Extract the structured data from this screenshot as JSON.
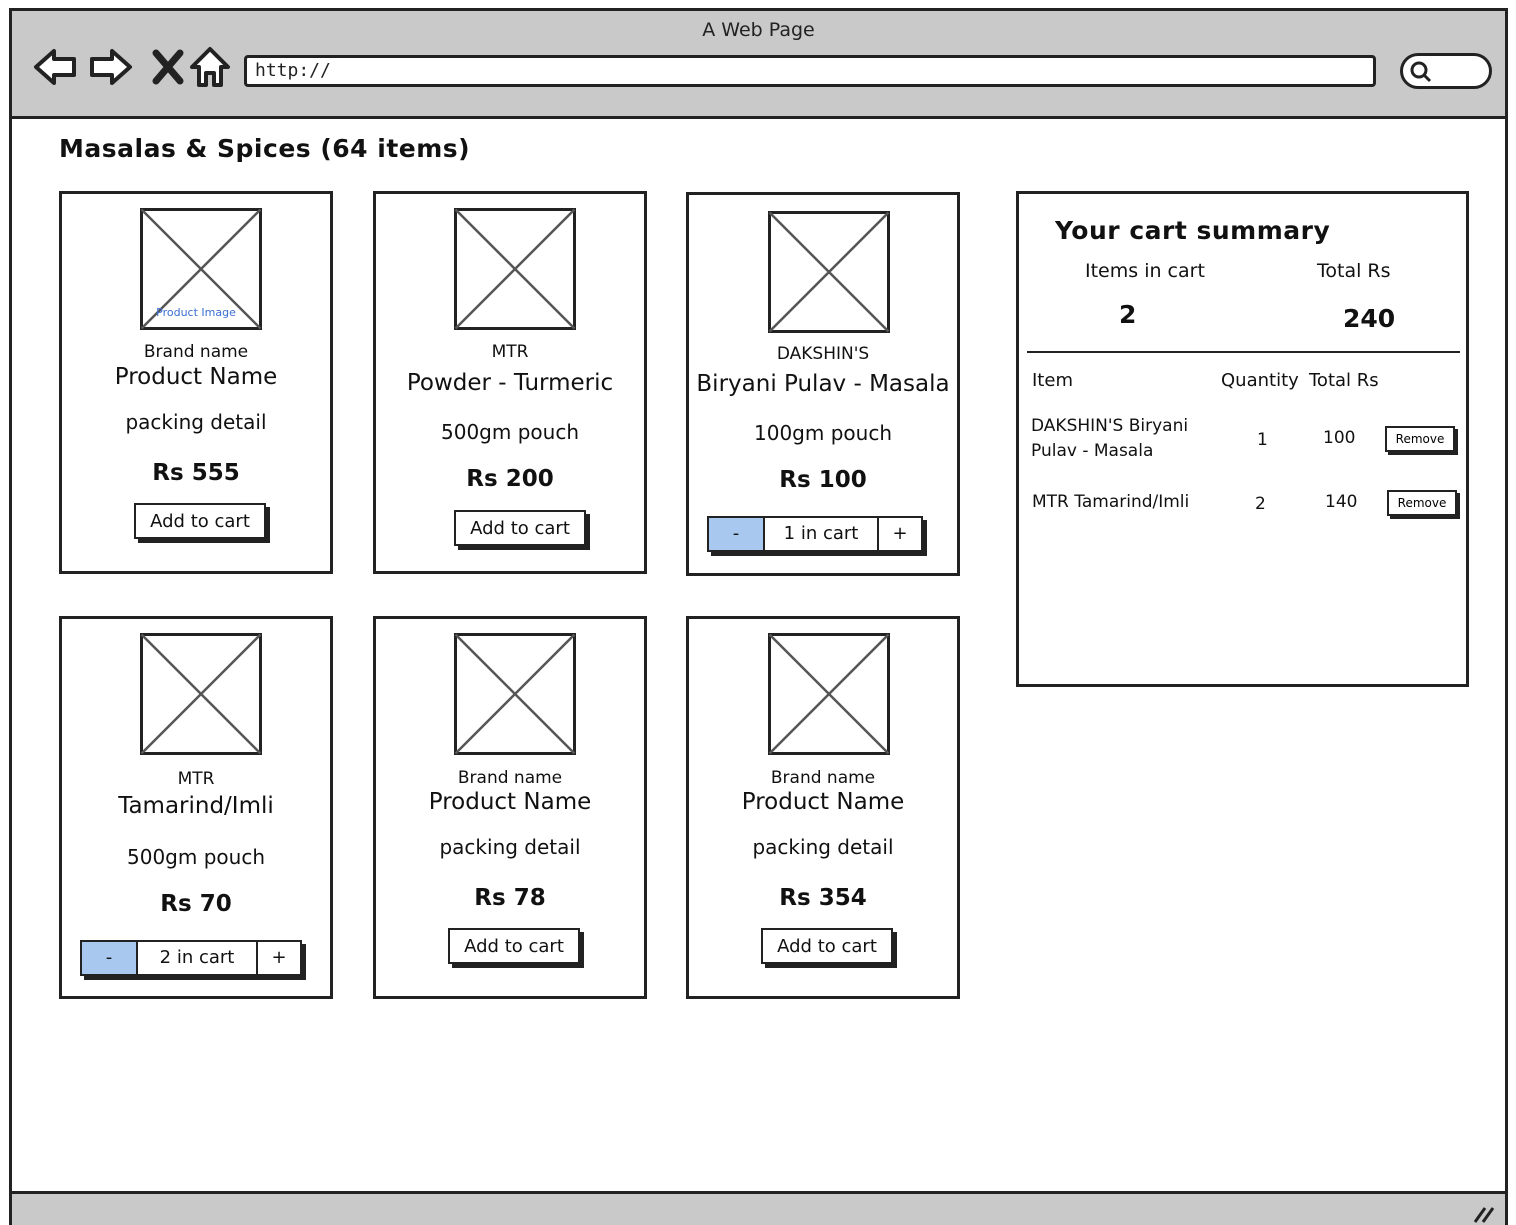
{
  "browser": {
    "window_title": "A Web Page",
    "url": "http://"
  },
  "page": {
    "heading": "Masalas & Spices (64 items)"
  },
  "products": [
    {
      "brand": "Brand name",
      "name": "Product Name",
      "packing": "packing detail",
      "price": "Rs 555",
      "image_caption": "Product Image",
      "action": "add",
      "button_label": "Add to cart"
    },
    {
      "brand": "MTR",
      "name": "Powder - Turmeric",
      "packing": "500gm pouch",
      "price": "Rs 200",
      "action": "add",
      "button_label": "Add to cart"
    },
    {
      "brand": "DAKSHIN'S",
      "name": "Biryani Pulav - Masala",
      "packing": "100gm pouch",
      "price": "Rs 100",
      "action": "stepper",
      "minus_label": "-",
      "count_label": "1 in cart",
      "plus_label": "+"
    },
    {
      "brand": "MTR",
      "name": "Tamarind/Imli",
      "packing": "500gm pouch",
      "price": "Rs 70",
      "action": "stepper",
      "minus_label": "-",
      "count_label": "2 in cart",
      "plus_label": "+"
    },
    {
      "brand": "Brand name",
      "name": "Product Name",
      "packing": "packing detail",
      "price": "Rs 78",
      "action": "add",
      "button_label": "Add to cart"
    },
    {
      "brand": "Brand name",
      "name": "Product Name",
      "packing": "packing detail",
      "price": "Rs 354",
      "action": "add",
      "button_label": "Add to cart"
    }
  ],
  "cart": {
    "title": "Your cart summary",
    "items_label": "Items in cart",
    "total_label": "Total Rs",
    "items_count": "2",
    "total_value": "240",
    "columns": {
      "item": "Item",
      "quantity": "Quantity",
      "total": "Total Rs"
    },
    "rows": [
      {
        "item_line1": "DAKSHIN'S Biryani",
        "item_line2": "Pulav - Masala",
        "quantity": "1",
        "total": "100",
        "remove_label": "Remove"
      },
      {
        "item_line1": "MTR Tamarind/Imli",
        "item_line2": "",
        "quantity": "2",
        "total": "140",
        "remove_label": "Remove"
      }
    ]
  },
  "colors": {
    "chrome_gray": "#c9c9c9",
    "stepper_minus": "#a8c8f0",
    "image_caption": "#3a6fd0"
  },
  "icons": [
    "back-icon",
    "forward-icon",
    "stop-icon",
    "home-icon",
    "search-icon",
    "resize-handle-icon",
    "image-placeholder-icon"
  ]
}
